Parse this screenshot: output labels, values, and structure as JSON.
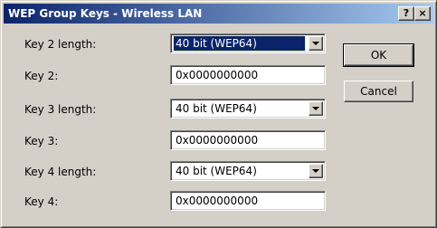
{
  "window": {
    "title": "WEP Group Keys - Wireless LAN",
    "help_label": "?",
    "close_label": "×"
  },
  "fields": [
    {
      "label": "Key 2 length:",
      "value": "40 bit (WEP64)"
    },
    {
      "label": "Key 2:",
      "value": "0x0000000000"
    },
    {
      "label": "Key 3 length:",
      "value": "40 bit (WEP64)"
    },
    {
      "label": "Key 3:",
      "value": "0x0000000000"
    },
    {
      "label": "Key 4 length:",
      "value": "40 bit (WEP64)"
    },
    {
      "label": "Key 4:",
      "value": "0x0000000000"
    }
  ],
  "buttons": {
    "ok": "OK",
    "cancel": "Cancel"
  },
  "colors": {
    "title_gradient_start": "#0a246a",
    "title_gradient_end": "#a6caf0",
    "dialog_face": "#d4d0c8",
    "selection": "#0a246a"
  },
  "icons": {
    "dropdown": "chevron-down-icon"
  }
}
